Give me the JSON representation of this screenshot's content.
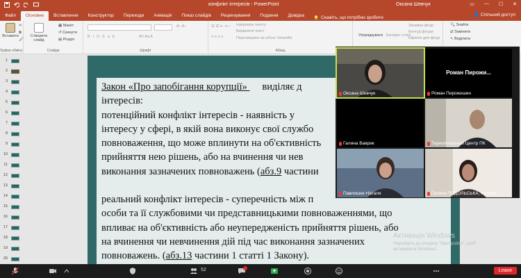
{
  "titlebar": {
    "doc_title": "конфлікт інтересів  -  PowerPoint",
    "user": "Оксана Шевчук"
  },
  "tabs": [
    "Файл",
    "Основне",
    "Вставлення",
    "Конструктор",
    "Переходи",
    "Анімація",
    "Показ слайдів",
    "Рецензування",
    "Подання",
    "Довідка"
  ],
  "tell_me": "Скажіть, що потрібно зробити",
  "share": "Спільний доступ",
  "ribbon": {
    "paste": "Вставити",
    "clipboard": "Буфер обміну",
    "new_slide": "Створити слайд",
    "layout": "Макет",
    "reset": "Скинути",
    "section": "Розділ",
    "slides_group": "Слайди",
    "font_group": "Шрифт",
    "text_direction": "Напрямок тексту",
    "align_text": "Вирівняти текст",
    "convert_smartart": "Перетворити на об'єкт SmartArt",
    "paragraph_group": "Абзац",
    "arrange": "Упорядкувати",
    "quick_styles": "Експрес-стилі",
    "shape_fill": "Заливка фігур",
    "shape_outline": "Контур фігури",
    "shape_effects": "Ефекти для фігур",
    "find": "Знайти",
    "replace": "Замінити",
    "select": "Виділити"
  },
  "slide_numbers": [
    "1",
    "2",
    "3",
    "4",
    "5",
    "6",
    "7",
    "8",
    "9",
    "10",
    "11",
    "12",
    "13",
    "14",
    "15",
    "16",
    "17",
    "18",
    "19",
    "20"
  ],
  "slide_text": {
    "p1": [
      [
        "Закон «Про запобігання корупції» ",
        "виділяє д"
      ],
      [
        "інтересів:",
        ""
      ],
      [
        "потенційний конфлікт інтересів - наявність у",
        ""
      ],
      [
        "інтересу у сфері, в якій вона виконує свої службо",
        ""
      ],
      [
        "повноваження, що може вплинути на об'єктивність",
        ""
      ],
      [
        "прийняття нею рішень, або на вчинення чи нев",
        ""
      ],
      [
        "виконання зазначених повноважень (",
        "абз.9",
        " частини"
      ]
    ],
    "p2": [
      "реальний конфлікт інтересів - суперечність між п",
      "особи та її службовими чи представницькими повноваженнями, що",
      "впливає на об'єктивність або неупередженість прийняття рішень, або",
      "на вчинення чи невчинення дій під час виконання зазначених"
    ],
    "p2_last_pre": "повноважень. (",
    "p2_last_link": "абз.13",
    "p2_last_post": " частини 1 статті 1 Закону)."
  },
  "watermark": {
    "title": "Активація Windows",
    "line1": "Перейдіть до розділу \"Настройки\", щоб",
    "line2": "активувати Windows."
  },
  "zoom": {
    "tiles": [
      {
        "name": "Оксана Шевчук",
        "type": "video",
        "active": true
      },
      {
        "name": "Роман Пирожишин",
        "label": "Роман  Пирожи...",
        "type": "avatar"
      },
      {
        "name": "Галина Ваврик",
        "type": "blank"
      },
      {
        "name": "Тернопільський Центр ПК",
        "type": "video"
      },
      {
        "name": "Павлишек Наталя",
        "type": "video"
      },
      {
        "name": "Галина ПОДОЛЬСЬКА,  Наталя ...",
        "type": "video"
      }
    ],
    "participants": "52",
    "leave": "Leave"
  },
  "colors": {
    "ppt_accent": "#b7472a",
    "slide_bg": "#2f6a68",
    "textbox_bg": "#e4ecec",
    "leave_red": "#e02828"
  }
}
